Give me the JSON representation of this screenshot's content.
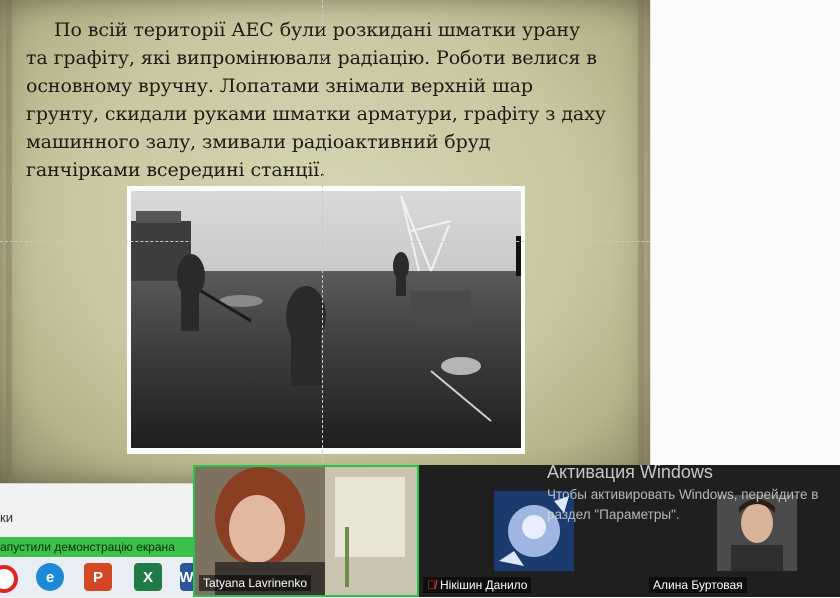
{
  "slide": {
    "text": "По всій території АЕС були розкидані шматки урану та графіту, які випромінювали радіацію. Роботи велися в основному вручну. Лопатами знімали верхній шар ґрунту, скидали руками шматки арматури, графіту з даху машинного залу, змивали радіоактивний бруд ганчірками всередині станції.",
    "lines": [
      "По всій території АЕС були розкидані шматки урану",
      "та графіту, які випромінювали радіацію. Роботи велися в",
      "основному вручну. Лопатами знімали верхній шар",
      "грунту, скидали руками шматки арматури, графіту з даху",
      "машинного залу, змивали радіоактивний бруд",
      "ганчірками всередині станції."
    ]
  },
  "left_panel": {
    "tab_label": "ки",
    "share_banner": "апустили демонстрацію екрана"
  },
  "taskbar": {
    "icons": [
      "opera-icon",
      "edge-icon",
      "powerpoint-icon",
      "excel-icon",
      "word-icon"
    ]
  },
  "participants": [
    {
      "name": "Tatyana Lavrinenko",
      "muted": false,
      "active_speaker": true
    },
    {
      "name": "Нікішин Данило",
      "muted": true,
      "active_speaker": false
    },
    {
      "name": "Алина Буртовая",
      "muted": false,
      "active_speaker": false
    }
  ],
  "activation": {
    "title": "Активация Windows",
    "body": "Чтобы активировать Windows, перейдите в раздел \"Параметры\"."
  },
  "colors": {
    "share_banner": "#3cc24a",
    "active_speaker_border": "#27c24a",
    "muted_mic": "#e0393b"
  }
}
